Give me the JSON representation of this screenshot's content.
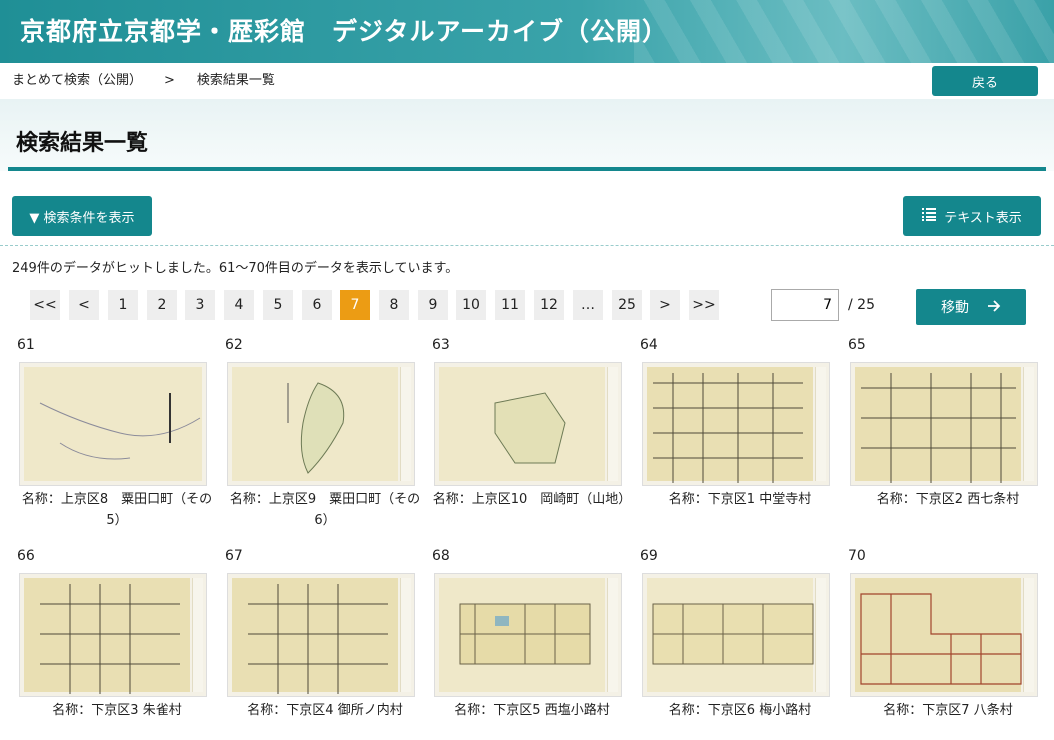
{
  "header": {
    "title": "京都府立京都学・歴彩館　デジタルアーカイブ（公開）"
  },
  "breadcrumb": {
    "item1": "まとめて検索（公開）",
    "sep": ">",
    "item2": "検索結果一覧"
  },
  "back_label": "戻る",
  "page_title": "検索結果一覧",
  "condition_button": "▼ 検索条件を表示",
  "text_view_button": "テキスト表示",
  "hit_message": "249件のデータがヒットしました。61～70件目のデータを表示しています。",
  "pager": {
    "first": "<<",
    "prev": "<",
    "pages": [
      "1",
      "2",
      "3",
      "4",
      "5",
      "6",
      "7",
      "8",
      "9",
      "10",
      "11",
      "12",
      "…",
      "25"
    ],
    "next": ">",
    "last": ">>",
    "current": "7",
    "input_value": "7",
    "total": "/ 25",
    "move_label": "移動"
  },
  "results": [
    {
      "num": "61",
      "name": "名称：上京区8　粟田口町（その5）"
    },
    {
      "num": "62",
      "name": "名称：上京区9　粟田口町（その6）"
    },
    {
      "num": "63",
      "name": "名称：上京区10　岡崎町（山地）"
    },
    {
      "num": "64",
      "name": "名称：下京区1 中堂寺村"
    },
    {
      "num": "65",
      "name": "名称：下京区2 西七条村"
    },
    {
      "num": "66",
      "name": "名称：下京区3 朱雀村"
    },
    {
      "num": "67",
      "name": "名称：下京区4 御所ノ内村"
    },
    {
      "num": "68",
      "name": "名称：下京区5 西塩小路村"
    },
    {
      "num": "69",
      "name": "名称：下京区6 梅小路村"
    },
    {
      "num": "70",
      "name": "名称：下京区7 八条村"
    }
  ],
  "colors": {
    "accent": "#14878d",
    "active_page": "#ec9c14"
  }
}
